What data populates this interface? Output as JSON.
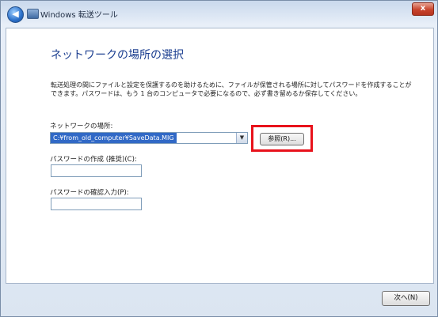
{
  "window": {
    "title": "Windows 転送ツール",
    "close_glyph": "x"
  },
  "header": {
    "back_glyph": "◀"
  },
  "page": {
    "heading": "ネットワークの場所の選択",
    "description": "転送処理の間にファイルと設定を保護するのを助けるために、ファイルが保管される場所に対してパスワードを作成することができます。パスワードは、もう 1 台のコンピュータで必要になるので、必ず書き留めるか保存してください。"
  },
  "location": {
    "label": "ネットワークの場所:",
    "value": "C:¥from_old_computer¥SaveData.MIG",
    "dropdown_glyph": "▼",
    "browse_label": "参照(R)..."
  },
  "password": {
    "create_label": "パスワードの作成 (推奨)(C):",
    "create_value": "",
    "confirm_label": "パスワードの確認入力(P):",
    "confirm_value": ""
  },
  "footer": {
    "next_label": "次へ(N)"
  },
  "colors": {
    "highlight_border": "#e8121b",
    "heading": "#1a3d8f",
    "selection": "#3169c6"
  }
}
